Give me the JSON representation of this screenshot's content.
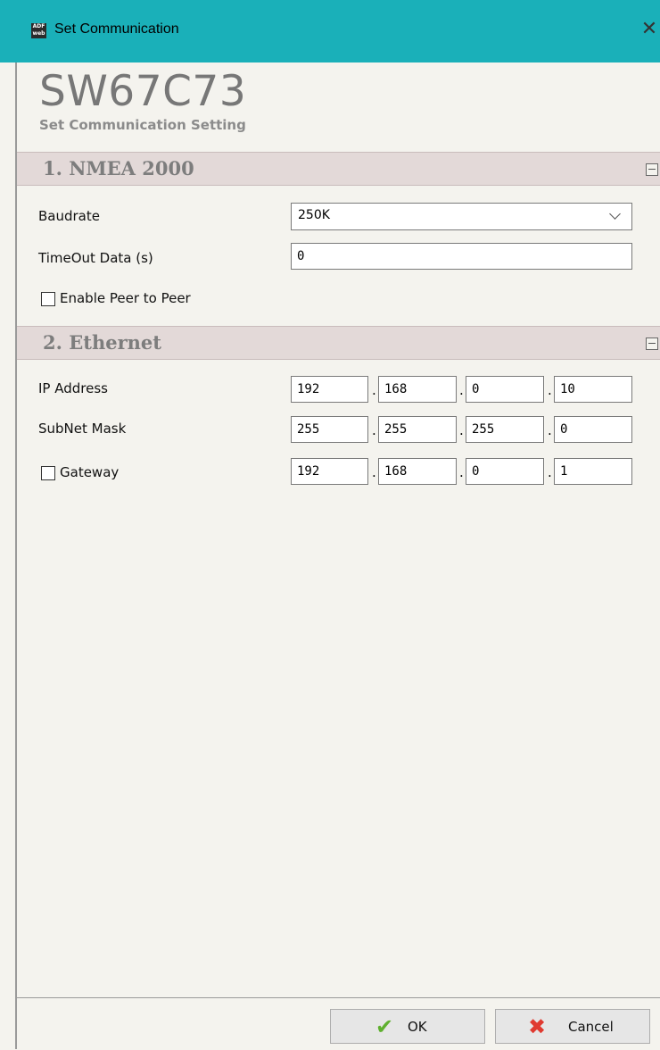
{
  "window": {
    "title": "Set Communication",
    "icon_text_top": "ADF",
    "icon_text_bottom": "web",
    "close_glyph": "✕"
  },
  "header": {
    "title": "SW67C73",
    "subtitle": "Set Communication Setting"
  },
  "sections": {
    "nmea": {
      "title": "1. NMEA 2000",
      "baudrate_label": "Baudrate",
      "baudrate_value": "250K",
      "timeout_label": "TimeOut Data (s)",
      "timeout_value": "0",
      "peer_label": "Enable Peer to Peer",
      "peer_checked": false
    },
    "ethernet": {
      "title": "2. Ethernet",
      "ip_label": "IP Address",
      "ip": [
        "192",
        "168",
        "0",
        "10"
      ],
      "mask_label": "SubNet Mask",
      "mask": [
        "255",
        "255",
        "255",
        "0"
      ],
      "gateway_label": "Gateway",
      "gateway_checked": false,
      "gateway": [
        "192",
        "168",
        "0",
        "1"
      ]
    }
  },
  "footer": {
    "ok_label": "OK",
    "cancel_label": "Cancel",
    "ok_icon": "check-icon",
    "cancel_icon": "red-x-icon"
  },
  "colors": {
    "titlebar": "#1ab0b9",
    "section_bar": "#e3d9d8",
    "background": "#f4f3ee"
  }
}
